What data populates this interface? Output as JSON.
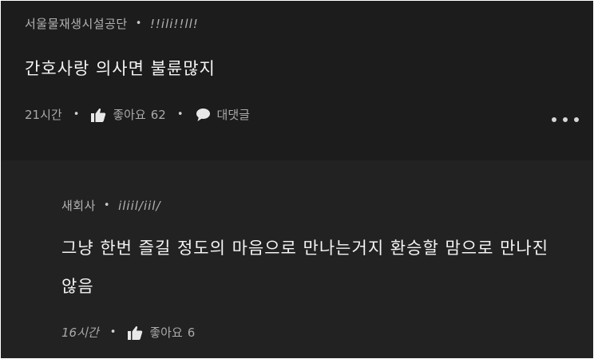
{
  "comments": [
    {
      "author": "서울물재생시설공단",
      "handle": "!!ili!!ll!",
      "text": "간호사랑 의사면 불륜많지",
      "time": "21시간",
      "like_label": "좋아요",
      "like_count": "62",
      "reply_label": "대댓글"
    },
    {
      "author": "새회사",
      "handle": "iliil/iil/",
      "text_line1": "그냥 한번 즐길 정도의 마음으로 만나는거지 환승할 맘으로 만나진",
      "text_line2": "않음",
      "time": "16시간",
      "like_label": "좋아요",
      "like_count": "6"
    }
  ],
  "icons": {
    "like": "thumbs-up-icon",
    "reply": "speech-bubble-icon",
    "more": "more-horizontal-icon"
  },
  "colors": {
    "background": "#1c1c1c",
    "reply_background": "#222222",
    "text_primary": "#f4f4f4",
    "text_secondary": "#b3b3b3",
    "icon": "#e8e8e8"
  }
}
